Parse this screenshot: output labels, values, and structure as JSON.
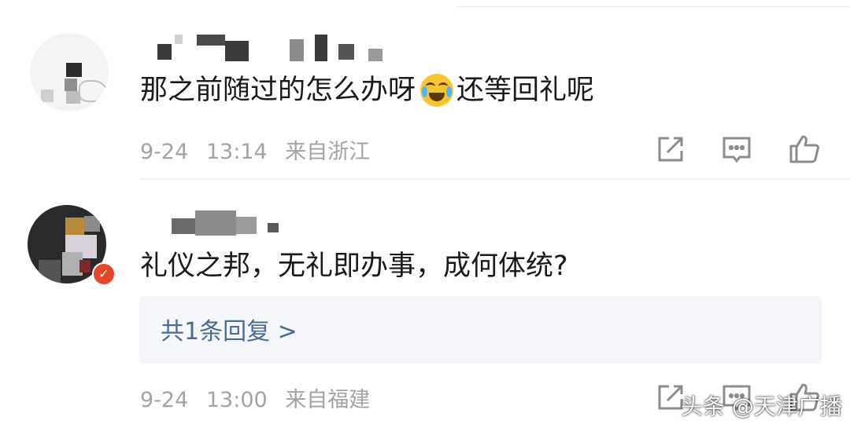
{
  "comments": [
    {
      "text_before_emoji": "那之前随过的怎么办呀",
      "emoji": "crying-laughing-emoji",
      "text_after_emoji": "还等回礼呢",
      "date": "9-24",
      "time": "13:14",
      "location": "来自浙江"
    },
    {
      "text": "礼仪之邦，无礼即办事，成何体统?",
      "reply_link": "共1条回复 >",
      "date": "9-24",
      "time": "13:00",
      "location": "来自福建"
    }
  ],
  "actions": [
    "share-icon",
    "comment-icon",
    "like-icon"
  ],
  "watermark": "头条 @天津广播",
  "colors": {
    "meta": "#a3a3a3",
    "reply_link": "#4b6b93",
    "reply_bg": "#f4f6f9",
    "verified_badge": "#e8462b"
  }
}
